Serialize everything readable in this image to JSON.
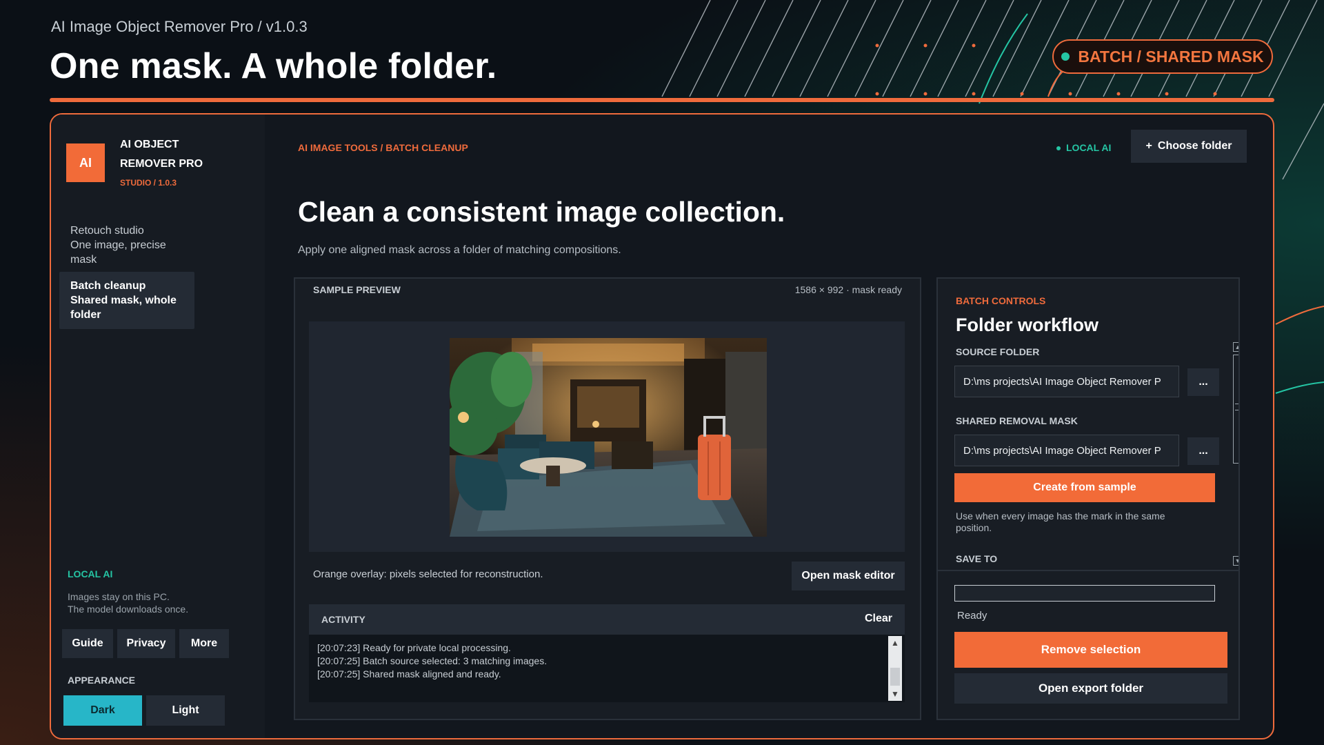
{
  "header": {
    "subtitle": "AI Image Object Remover Pro  /  v1.0.3",
    "title": "One mask. A whole folder.",
    "badge": "BATCH / SHARED MASK"
  },
  "sidebar": {
    "logo": "AI",
    "brand_name": "AI OBJECT REMOVER PRO",
    "brand_sub": "STUDIO / 1.0.3",
    "nav": [
      {
        "label": "Retouch studio",
        "sub": "One image, precise mask",
        "active": false
      },
      {
        "label": "Batch cleanup",
        "sub": "Shared mask, whole folder",
        "active": true
      }
    ],
    "local_title": "LOCAL AI",
    "local_note": "Images stay on this PC.\nThe model downloads once.",
    "buttons": [
      "Guide",
      "Privacy",
      "More"
    ],
    "appearance_label": "APPEARANCE",
    "appearance_options": [
      "Dark",
      "Light"
    ],
    "appearance_selected": "Dark"
  },
  "main": {
    "breadcrumb": "AI IMAGE TOOLS  /  BATCH CLEANUP",
    "local_indicator": "LOCAL AI",
    "choose_folder": "Choose folder",
    "title": "Clean a consistent image collection.",
    "description": "Apply one aligned mask across a folder of matching compositions."
  },
  "preview": {
    "label": "SAMPLE PREVIEW",
    "meta": "1586 × 992  ·  mask ready",
    "hint": "Orange overlay: pixels selected for reconstruction.",
    "mask_button": "Open mask editor",
    "activity_label": "ACTIVITY",
    "clear_label": "Clear",
    "log": [
      "[20:07:23]  Ready for private local processing.",
      "[20:07:25]  Batch source selected: 3 matching images.",
      "[20:07:25]  Shared mask aligned and ready."
    ]
  },
  "controls": {
    "label": "BATCH CONTROLS",
    "title": "Folder workflow",
    "source_label": "SOURCE FOLDER",
    "source_value": "D:\\ms projects\\AI Image Object Remover P",
    "mask_label": "SHARED REMOVAL MASK",
    "mask_value": "D:\\ms projects\\AI Image Object Remover P",
    "browse": "...",
    "create_button": "Create from sample",
    "note": "Use when every image has the mark in the same position.",
    "save_label": "SAVE TO",
    "progress": 0,
    "status": "Ready",
    "remove_button": "Remove selection",
    "export_button": "Open export folder"
  },
  "colors": {
    "accent": "#f26b38",
    "teal": "#25c5a4",
    "cyan": "#27b6c8",
    "panel": "#181d24",
    "background": "#0b1016"
  }
}
